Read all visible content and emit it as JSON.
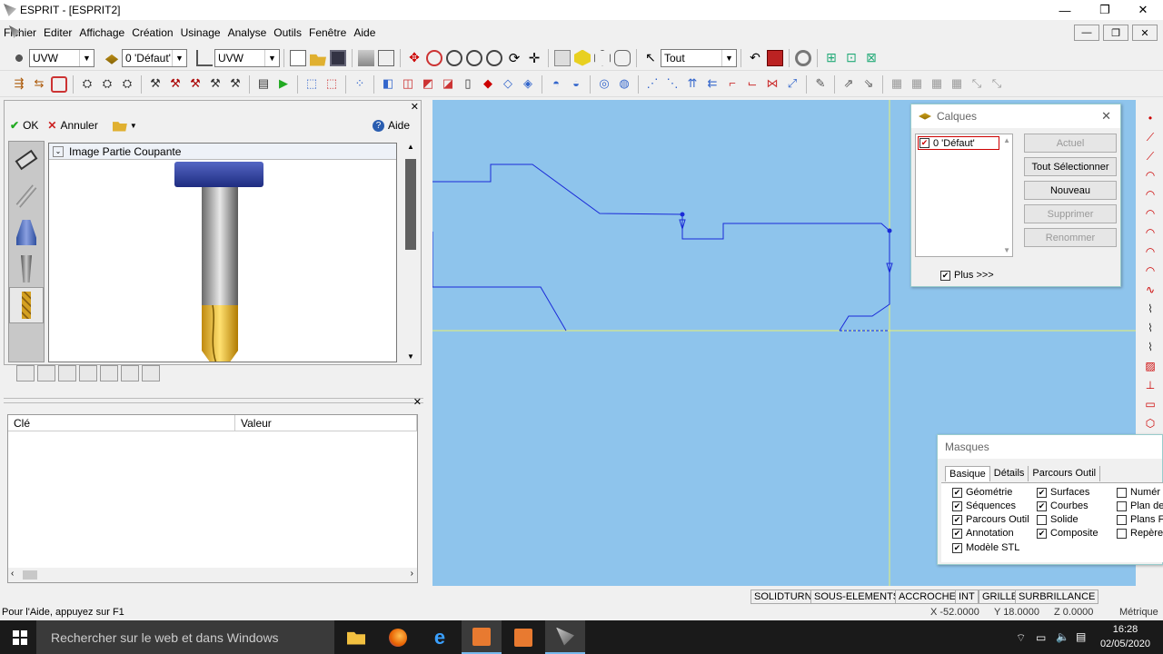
{
  "window": {
    "title": "ESPRIT - [ESPRIT2]",
    "minimize": "—",
    "maximize": "❐",
    "close": "✕"
  },
  "menu": {
    "items": [
      "Fichier",
      "Editer",
      "Affichage",
      "Création",
      "Usinage",
      "Analyse",
      "Outils",
      "Fenêtre",
      "Aide"
    ]
  },
  "toolbar1": {
    "plane1": "UVW",
    "layer": "0 'Défaut'",
    "plane2": "UVW",
    "filter": "Tout"
  },
  "toolpanel": {
    "ok": "OK",
    "cancel": "Annuler",
    "help": "Aide",
    "section_title": "Image Partie Coupante"
  },
  "properties": {
    "col_key": "Clé",
    "col_value": "Valeur"
  },
  "calques": {
    "title": "Calques",
    "layer_item": "0 'Défaut'",
    "btn_actuel": "Actuel",
    "btn_select_all": "Tout Sélectionner",
    "btn_new": "Nouveau",
    "btn_delete": "Supprimer",
    "btn_rename": "Renommer",
    "plus": "Plus >>>"
  },
  "masques": {
    "title": "Masques",
    "tabs": [
      "Basique",
      "Détails",
      "Parcours Outil"
    ],
    "col1": [
      {
        "label": "Géométrie",
        "checked": true
      },
      {
        "label": "Séquences",
        "checked": true
      },
      {
        "label": "Parcours Outil",
        "checked": true
      },
      {
        "label": "Annotation",
        "checked": true
      },
      {
        "label": "Modèle STL",
        "checked": true
      }
    ],
    "col2": [
      {
        "label": "Surfaces",
        "checked": true
      },
      {
        "label": "Courbes",
        "checked": true
      },
      {
        "label": "Solide",
        "checked": false
      },
      {
        "label": "Composite",
        "checked": true
      }
    ],
    "col3": [
      {
        "label": "Numér",
        "checked": false
      },
      {
        "label": "Plan de",
        "checked": false
      },
      {
        "label": "Plans F",
        "checked": false
      },
      {
        "label": "Repère",
        "checked": false
      }
    ]
  },
  "status": {
    "help_text": "Pour l'Aide, appuyez sur F1",
    "cells": [
      "SOLIDTURN",
      "SOUS-ELEMENTS",
      "ACCROCHE",
      "INT",
      "GRILLE",
      "SURBRILLANCE"
    ],
    "x": "X -52.0000",
    "y": "Y 18.0000",
    "z": "Z 0.0000",
    "units": "Métrique"
  },
  "taskbar": {
    "search": "Rechercher sur le web et dans Windows",
    "time": "16:28",
    "date": "02/05/2020"
  },
  "colors": {
    "viewport_bg": "#8ec4ec",
    "profile_line": "#1a2ad8",
    "axis_line": "#e8f070",
    "tool_holder": "#2c3ea0",
    "tool_tip": "#f0c020"
  }
}
